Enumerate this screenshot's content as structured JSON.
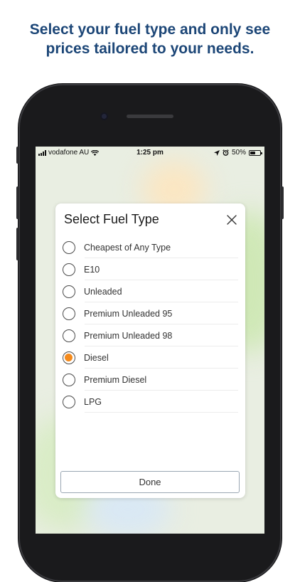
{
  "headline": {
    "line1": "Select your fuel type and only see",
    "line2": "prices tailored to your needs."
  },
  "statusbar": {
    "carrier": "vodafone AU",
    "time": "1:25 pm",
    "battery_percent": "50%",
    "battery_level": 0.5,
    "icons": [
      "signal-bars-icon",
      "wifi-icon",
      "location-arrow-icon",
      "alarm-icon",
      "battery-icon"
    ]
  },
  "modal": {
    "title": "Select Fuel Type",
    "close_icon": "close-icon",
    "options": [
      {
        "label": "Cheapest of Any Type",
        "selected": false
      },
      {
        "label": "E10",
        "selected": false
      },
      {
        "label": "Unleaded",
        "selected": false
      },
      {
        "label": "Premium Unleaded 95",
        "selected": false
      },
      {
        "label": "Premium Unleaded 98",
        "selected": false
      },
      {
        "label": "Diesel",
        "selected": true
      },
      {
        "label": "Premium Diesel",
        "selected": false
      },
      {
        "label": "LPG",
        "selected": false
      }
    ],
    "done_label": "Done"
  },
  "colors": {
    "headline": "#1c4677",
    "accent": "#f48a1c",
    "phone_frame": "#1a1a1c"
  }
}
